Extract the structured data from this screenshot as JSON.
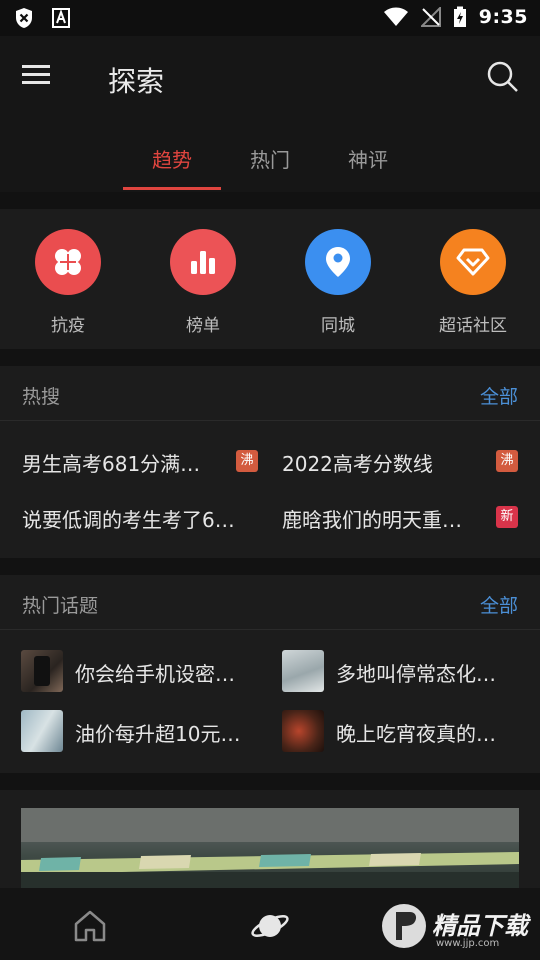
{
  "status_bar": {
    "time": "9:35"
  },
  "header": {
    "title": "探索"
  },
  "tabs": [
    {
      "label": "趋势",
      "active": true
    },
    {
      "label": "热门",
      "active": false
    },
    {
      "label": "神评",
      "active": false
    }
  ],
  "quick_links": [
    {
      "label": "抗疫",
      "icon": "clover-icon",
      "color": "#ea4d4f"
    },
    {
      "label": "榜单",
      "icon": "bar-chart-icon",
      "color": "#ec5356"
    },
    {
      "label": "同城",
      "icon": "location-pin-icon",
      "color": "#3b8ff0"
    },
    {
      "label": "超话社区",
      "icon": "diamond-icon",
      "color": "#f5821f"
    }
  ],
  "hot_search": {
    "title": "热搜",
    "more": "全部",
    "items": [
      {
        "text": "男生高考681分满…",
        "badge": "沸"
      },
      {
        "text": "2022高考分数线",
        "badge": "沸"
      },
      {
        "text": "说要低调的考生考了6…",
        "badge": ""
      },
      {
        "text": "鹿晗我们的明天重…",
        "badge": "新"
      }
    ]
  },
  "hot_topics": {
    "title": "热门话题",
    "more": "全部",
    "items": [
      {
        "text": "你会给手机设密…"
      },
      {
        "text": "多地叫停常态化…"
      },
      {
        "text": "油价每升超10元…"
      },
      {
        "text": "晚上吃宵夜真的…"
      }
    ]
  },
  "watermark": {
    "text": "精品下载",
    "url_text": "www.jjp.com"
  }
}
